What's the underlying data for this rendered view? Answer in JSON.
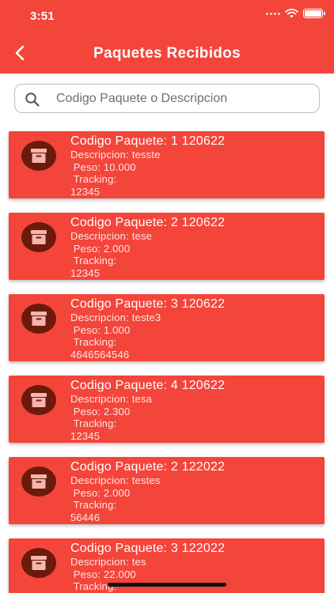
{
  "status_bar": {
    "time": "3:51"
  },
  "header": {
    "title": "Paquetes Recibidos"
  },
  "search": {
    "placeholder": "Codigo Paquete o Descripcion",
    "value": ""
  },
  "colors": {
    "primary": "#f4453b",
    "avatar_bg": "#6b1a0c",
    "box_icon": "#f5b5ad"
  },
  "icons": {
    "back": "chevron-left-icon",
    "search": "search-icon",
    "package": "archive-box-icon"
  },
  "packages": [
    {
      "title": "Codigo Paquete: 1 120622",
      "descripcion": "Descripcion: tesste",
      "peso": " Peso: 10.000",
      "tracking_label": " Tracking:",
      "tracking": "12345"
    },
    {
      "title": "Codigo Paquete: 2 120622",
      "descripcion": "Descripcion: tese",
      "peso": " Peso: 2.000",
      "tracking_label": " Tracking:",
      "tracking": "12345"
    },
    {
      "title": "Codigo Paquete: 3 120622",
      "descripcion": "Descripcion: teste3",
      "peso": " Peso: 1.000",
      "tracking_label": " Tracking:",
      "tracking": "4646564546"
    },
    {
      "title": "Codigo Paquete: 4 120622",
      "descripcion": "Descripcion: tesa",
      "peso": " Peso: 2.300",
      "tracking_label": " Tracking:",
      "tracking": "12345"
    },
    {
      "title": "Codigo Paquete: 2 122022",
      "descripcion": "Descripcion: testes",
      "peso": " Peso: 2.000",
      "tracking_label": " Tracking:",
      "tracking": "56446"
    },
    {
      "title": "Codigo Paquete: 3 122022",
      "descripcion": "Descripcion: tes",
      "peso": " Peso: 22.000",
      "tracking_label": " Tracking:",
      "tracking": ""
    }
  ]
}
